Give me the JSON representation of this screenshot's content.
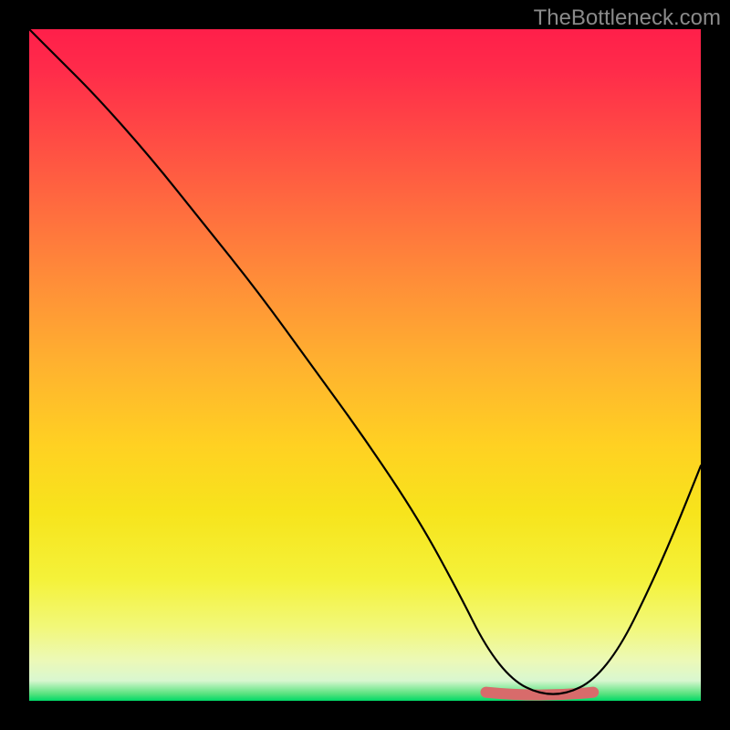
{
  "watermark": "TheBottleneck.com",
  "chart_data": {
    "type": "line",
    "title": "",
    "xlabel": "",
    "ylabel": "",
    "xlim": [
      0,
      100
    ],
    "ylim": [
      0,
      100
    ],
    "grid": false,
    "legend": false,
    "background_gradient": {
      "top": "#ff1f4a",
      "mid": "#ffd122",
      "bottom": "#00d968"
    },
    "series": [
      {
        "name": "bottleneck-curve",
        "color": "#000000",
        "x": [
          0,
          4,
          10,
          18,
          26,
          34,
          42,
          50,
          58,
          64,
          68,
          72,
          76,
          80,
          84,
          88,
          92,
          96,
          100
        ],
        "values": [
          100,
          96,
          90,
          81,
          71,
          61,
          50,
          39,
          27,
          16,
          8,
          3,
          1,
          1,
          3,
          8,
          16,
          25,
          35
        ]
      }
    ],
    "optimal_range": {
      "name": "optimal-basin",
      "color": "#d86b6b",
      "x_start": 68,
      "x_end": 84,
      "y": 1
    }
  }
}
